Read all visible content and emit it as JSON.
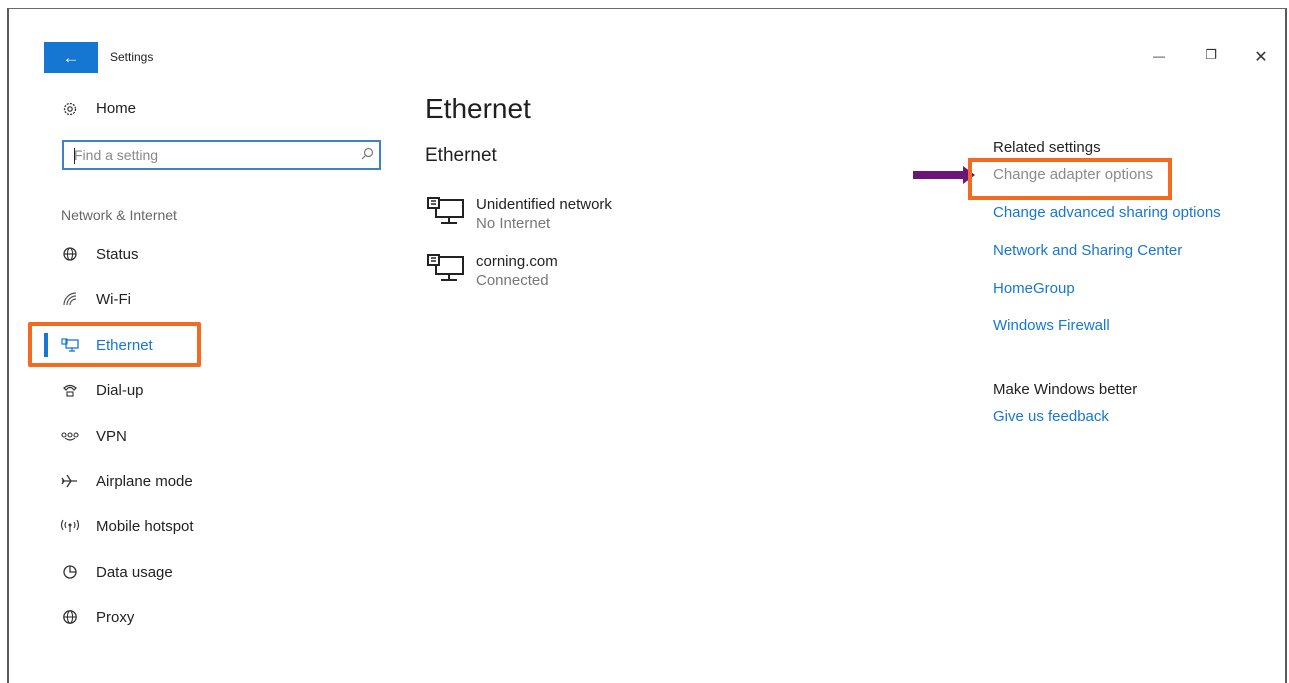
{
  "window": {
    "title": "Settings",
    "back_icon": "←",
    "minimize_icon": "—",
    "restore_icon": "❐",
    "close_icon": "✕"
  },
  "sidebar": {
    "home": {
      "label": "Home",
      "icon": "gear-icon"
    },
    "search": {
      "placeholder": "Find a setting"
    },
    "group_label": "Network & Internet",
    "items": [
      {
        "label": "Status",
        "icon": "globe-status-icon"
      },
      {
        "label": "Wi-Fi",
        "icon": "wifi-icon"
      },
      {
        "label": "Ethernet",
        "icon": "ethernet-icon",
        "active": true
      },
      {
        "label": "Dial-up",
        "icon": "dialup-icon"
      },
      {
        "label": "VPN",
        "icon": "vpn-icon"
      },
      {
        "label": "Airplane mode",
        "icon": "airplane-icon"
      },
      {
        "label": "Mobile hotspot",
        "icon": "hotspot-icon"
      },
      {
        "label": "Data usage",
        "icon": "data-usage-icon"
      },
      {
        "label": "Proxy",
        "icon": "globe-icon"
      }
    ]
  },
  "main": {
    "page_title": "Ethernet",
    "section_title": "Ethernet",
    "networks": [
      {
        "name": "Unidentified network",
        "status": "No Internet"
      },
      {
        "name": "corning.com",
        "status": "Connected"
      }
    ]
  },
  "related": {
    "heading": "Related settings",
    "links": [
      "Change adapter options",
      "Change advanced sharing options",
      "Network and Sharing Center",
      "HomeGroup",
      "Windows Firewall"
    ],
    "feedback_heading": "Make Windows better",
    "feedback_link": "Give us feedback"
  },
  "colors": {
    "accent": "#1677d2",
    "highlight_box": "#f26b21",
    "annotation_arrow": "#6a1577"
  }
}
